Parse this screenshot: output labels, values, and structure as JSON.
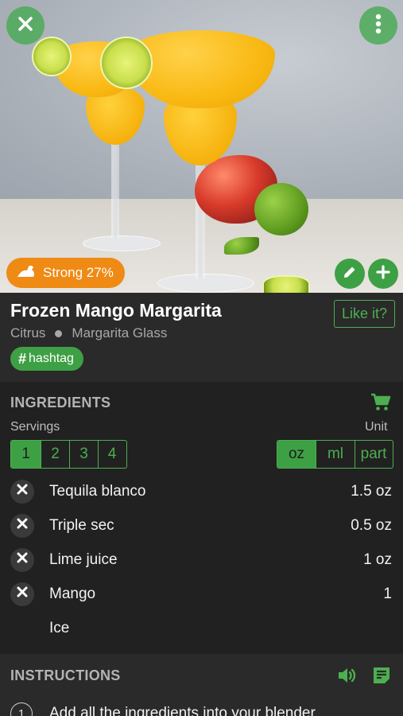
{
  "header": {
    "close_icon": "close-icon",
    "menu_icon": "more-vertical-icon"
  },
  "hero": {
    "strength_label": "Strong 27%",
    "strength_icon": "strength-arm-icon",
    "edit_icon": "pencil-icon",
    "add_icon": "plus-icon"
  },
  "recipe": {
    "title": "Frozen Mango Margarita",
    "like_label": "Like it?",
    "category": "Citrus",
    "glass": "Margarita Glass",
    "hashtag": "hashtag"
  },
  "ingredients": {
    "heading": "INGREDIENTS",
    "cart_icon": "cart-icon",
    "servings_label": "Servings",
    "unit_label": "Unit",
    "servings_options": [
      "1",
      "2",
      "3",
      "4"
    ],
    "servings_selected": "1",
    "unit_options": [
      "oz",
      "ml",
      "part"
    ],
    "unit_selected": "oz",
    "items": [
      {
        "name": "Tequila blanco",
        "amount": "1.5 oz",
        "removable": true
      },
      {
        "name": "Triple sec",
        "amount": "0.5 oz",
        "removable": true
      },
      {
        "name": "Lime juice",
        "amount": "1 oz",
        "removable": true
      },
      {
        "name": "Mango",
        "amount": "1",
        "removable": true
      },
      {
        "name": "Ice",
        "amount": "",
        "removable": false
      }
    ]
  },
  "instructions": {
    "heading": "INSTRUCTIONS",
    "speaker_icon": "speaker-icon",
    "notes_icon": "notes-icon",
    "steps": [
      {
        "number": "1",
        "text": "Add all the ingredients into your blender"
      }
    ]
  },
  "colors": {
    "accent": "#4caf50",
    "accent_fill": "#3ea045",
    "strength_badge": "#ef8a14",
    "background": "#212121"
  }
}
